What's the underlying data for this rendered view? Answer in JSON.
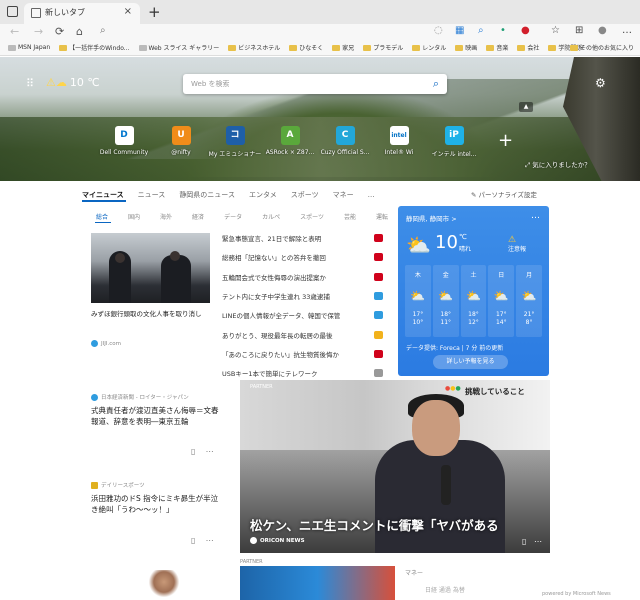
{
  "tab": {
    "title": "新しいタブ",
    "close": "×",
    "new": "+"
  },
  "toolbar": {
    "refresh": "⟳",
    "home": "⌂",
    "search": "⌕"
  },
  "bookmarks": [
    {
      "label": "MSN Japan",
      "color": "#bbbbbb"
    },
    {
      "label": "【一括伴手のWindo...",
      "color": "#e8c14a"
    },
    {
      "label": "Web スライス ギャラリー",
      "color": "#bbbbbb"
    },
    {
      "label": "ビジネスホテル",
      "color": "#e8c14a"
    },
    {
      "label": "ひなそく",
      "color": "#e8c14a"
    },
    {
      "label": "家兄",
      "color": "#e8c14a"
    },
    {
      "label": "プラモデル",
      "color": "#e8c14a"
    },
    {
      "label": "レンタル",
      "color": "#e8c14a"
    },
    {
      "label": "映画",
      "color": "#e8c14a"
    },
    {
      "label": "音楽",
      "color": "#e8c14a"
    },
    {
      "label": "会社",
      "color": "#e8c14a"
    },
    {
      "label": "学院関係",
      "color": "#e8c14a"
    }
  ],
  "bookmarks_more": "その他のお気に入り",
  "hero": {
    "temp": "10 ℃",
    "search_placeholder": "Web を検索",
    "like_image": "気に入りましたか？"
  },
  "quick_links": [
    {
      "label": "Dell Community",
      "icon": "D",
      "color": "#ffffff",
      "fg": "#0076ce"
    },
    {
      "label": "@nifty",
      "icon": "U",
      "color": "#f08c1a",
      "fg": "#ffffff"
    },
    {
      "label": "My エミュショナー",
      "icon": "コ",
      "color": "#1e5fa8",
      "fg": "#ffffff"
    },
    {
      "label": "ASRock × Z87...",
      "icon": "A",
      "color": "#5aa83b",
      "fg": "#ffffff"
    },
    {
      "label": "Cuzy Official S...",
      "icon": "C",
      "color": "#22a7d8",
      "fg": "#ffffff"
    },
    {
      "label": "Intel® Wi",
      "icon": "intel",
      "color": "#ffffff",
      "fg": "#0071c5"
    },
    {
      "label": "インテル intel...",
      "icon": "iP",
      "color": "#1fb2e8",
      "fg": "#ffffff"
    }
  ],
  "nav": {
    "items": [
      "マイニュース",
      "ニュース",
      "静岡県のニュース",
      "エンタメ",
      "スポーツ",
      "マネー",
      "…"
    ],
    "personalize": "パーソナライズ設定",
    "sub": [
      "総合",
      "国内",
      "海外",
      "経済",
      "データ",
      "カルペ",
      "スポーツ",
      "芸能",
      "運転"
    ]
  },
  "feature_left": {
    "title": "みずほ銀行頭取の文化人事を取り消し",
    "source": "JIJI.com"
  },
  "headlines": [
    {
      "text": "緊急事態宣言、21日で解除と表明",
      "color": "#d0021b"
    },
    {
      "text": "総務相「記憶ない」との答弁を撤回",
      "color": "#d0021b"
    },
    {
      "text": "五輪開会式で女性侮辱の演出提案か",
      "color": "#d0021b"
    },
    {
      "text": "テント内に女子中学生連れ 33歳逮捕",
      "color": "#2f9cdf"
    },
    {
      "text": "LINEの個人情報が全データ、韓国で保管",
      "color": "#2f9cdf"
    },
    {
      "text": "ありがとう、現役最年長の転居の最後",
      "color": "#f2b21c"
    },
    {
      "text": "「あのころに戻りたい」抗生物質後悔か",
      "color": "#d0021b"
    },
    {
      "text": "USBキー1本で簡単にテレワーク",
      "color": "#999999"
    }
  ],
  "weather": {
    "location": "静岡県, 静岡市 >",
    "more": "…",
    "temp": "10",
    "unit": "℃",
    "condition": "晴れ",
    "alert": "注意報",
    "forecast": [
      {
        "day": "木",
        "hi": "17°",
        "lo": "10°"
      },
      {
        "day": "金",
        "hi": "18°",
        "lo": "11°"
      },
      {
        "day": "土",
        "hi": "18°",
        "lo": "12°"
      },
      {
        "day": "日",
        "hi": "17°",
        "lo": "14°"
      },
      {
        "day": "月",
        "hi": "21°",
        "lo": "8°"
      }
    ],
    "source": "データ提供: Foreca | 7 分 前の更新",
    "button": "詳しい予報を見る"
  },
  "card1": {
    "source": "日本経済新聞 - ロイター・ジャパン",
    "title": "式典責任者が渡辺直美さん侮辱＝文春報道、辞意を表明―東京五輪"
  },
  "card2": {
    "source": "デイリースポーツ",
    "title": "浜田雅功のドS 指令にミキ昴生が半泣き絶叫「うわ～～ッ！」"
  },
  "big_feature": {
    "partner": "PARTNER",
    "caption_top": "挑戦していること",
    "headline": "松ケン、ニエ生コメントに衝撃「ヤバがある",
    "source": "ORICON NEWS"
  },
  "bottom": {
    "partner": "PARTNER",
    "money": "マネー",
    "money2": "日経  通過  為替",
    "powered": "powered by Microsoft News"
  }
}
